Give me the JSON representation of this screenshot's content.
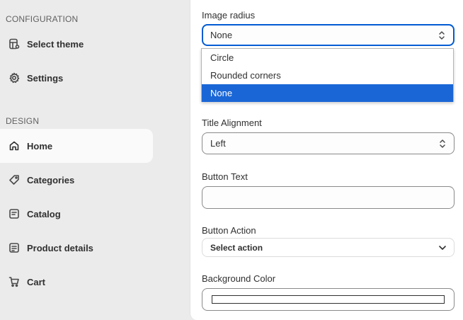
{
  "sidebar": {
    "configuration_heading": "CONFIGURATION",
    "design_heading": "DESIGN",
    "config_items": [
      {
        "label": "Select theme",
        "icon": "theme-icon"
      },
      {
        "label": "Settings",
        "icon": "gear-icon"
      }
    ],
    "design_items": [
      {
        "label": "Home",
        "icon": "home-icon",
        "active": true
      },
      {
        "label": "Categories",
        "icon": "tag-icon"
      },
      {
        "label": "Catalog",
        "icon": "catalog-icon"
      },
      {
        "label": "Product details",
        "icon": "product-details-icon"
      },
      {
        "label": "Cart",
        "icon": "cart-icon"
      }
    ]
  },
  "form": {
    "image_radius": {
      "label": "Image radius",
      "value": "None",
      "options": [
        "Circle",
        "Rounded corners",
        "None"
      ],
      "selected_option": "None"
    },
    "title_alignment": {
      "label": "Title Alignment",
      "value": "Left"
    },
    "button_text": {
      "label": "Button Text",
      "value": ""
    },
    "button_action": {
      "label": "Button Action",
      "value": "Select action"
    },
    "background_color": {
      "label": "Background Color",
      "value": "#ffffff"
    }
  },
  "colors": {
    "focus_border": "#005bd3",
    "selected_option_bg": "#1a66d6",
    "sidebar_bg": "#ebebeb",
    "active_nav_bg": "#fafafa"
  }
}
